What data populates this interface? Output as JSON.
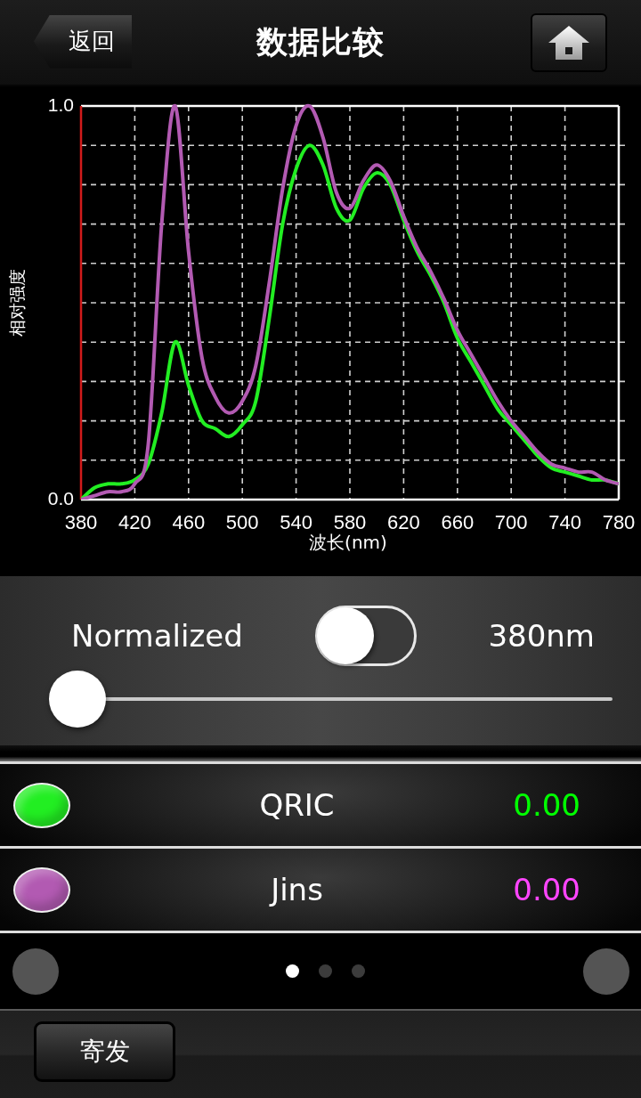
{
  "header": {
    "back_button": "返回",
    "title": "数据比较"
  },
  "chart": {
    "chart_data": {
      "type": "line",
      "xlabel": "波长(nm)",
      "ylabel": "相对强度",
      "grid": true,
      "x": [
        380,
        390,
        400,
        410,
        420,
        430,
        440,
        450,
        460,
        470,
        480,
        490,
        500,
        510,
        520,
        530,
        540,
        550,
        560,
        570,
        580,
        590,
        600,
        610,
        620,
        630,
        640,
        650,
        660,
        670,
        680,
        690,
        700,
        710,
        720,
        730,
        740,
        750,
        760,
        770,
        780
      ],
      "series": [
        {
          "color": "#22ee22",
          "values": [
            0.0,
            0.03,
            0.04,
            0.04,
            0.05,
            0.09,
            0.22,
            0.4,
            0.29,
            0.2,
            0.18,
            0.16,
            0.19,
            0.25,
            0.46,
            0.7,
            0.84,
            0.9,
            0.85,
            0.74,
            0.71,
            0.79,
            0.83,
            0.8,
            0.71,
            0.63,
            0.57,
            0.5,
            0.41,
            0.35,
            0.29,
            0.23,
            0.19,
            0.15,
            0.11,
            0.08,
            0.07,
            0.06,
            0.05,
            0.05,
            0.04
          ]
        },
        {
          "color": "#b25ab2",
          "values": [
            0.0,
            0.01,
            0.02,
            0.02,
            0.04,
            0.14,
            0.7,
            1.0,
            0.63,
            0.36,
            0.26,
            0.22,
            0.25,
            0.34,
            0.55,
            0.79,
            0.95,
            1.0,
            0.92,
            0.78,
            0.74,
            0.81,
            0.85,
            0.81,
            0.72,
            0.64,
            0.58,
            0.51,
            0.43,
            0.37,
            0.31,
            0.25,
            0.2,
            0.16,
            0.12,
            0.09,
            0.08,
            0.07,
            0.07,
            0.05,
            0.04
          ]
        }
      ],
      "xlim": [
        380,
        780
      ],
      "ylim": [
        0,
        1
      ],
      "xticks": [
        380,
        420,
        460,
        500,
        540,
        580,
        620,
        660,
        700,
        740,
        780
      ],
      "yticks": [
        {
          "value": 0,
          "label": "0.0"
        },
        {
          "value": 1,
          "label": "1.0"
        }
      ]
    }
  },
  "controls": {
    "normalized_label": "Normalized",
    "normalized_on": false,
    "wavelength": "380nm",
    "slider": {
      "level": 0
    }
  },
  "legend": [
    {
      "name": "QRIC",
      "value": "0.00",
      "color": "#22ee22"
    },
    {
      "name": "Jins",
      "value": "0.00",
      "color": "#b25ab2"
    }
  ],
  "pager": {
    "pages": [
      {
        "selected": true
      },
      {
        "selected": false
      },
      {
        "selected": false
      }
    ]
  },
  "footer": {
    "button": "寄发"
  }
}
